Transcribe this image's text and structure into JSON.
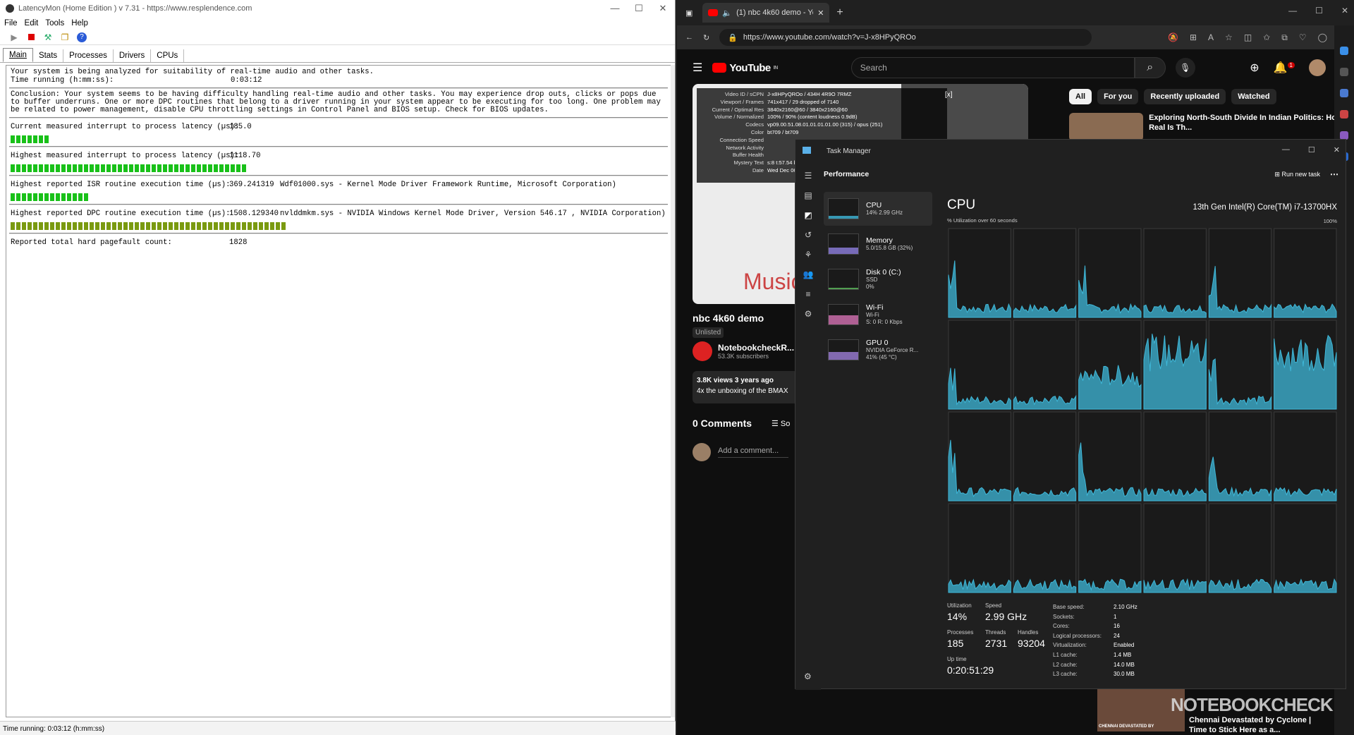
{
  "latencymon": {
    "title": "LatencyMon (Home Edition ) v 7.31 - https://www.resplendence.com",
    "menu": [
      "File",
      "Edit",
      "Tools",
      "Help"
    ],
    "tabs": [
      "Main",
      "Stats",
      "Processes",
      "Drivers",
      "CPUs"
    ],
    "line1": "Your system is being analyzed for suitability of real-time audio and other tasks.",
    "time_label": "Time running (h:mm:ss):",
    "time_value": "0:03:12",
    "conclusion": "Conclusion: Your system seems to be having difficulty handling real-time audio and other tasks. You may experience drop outs, clicks or pops due to buffer underruns. One or more DPC routines that belong to a driver running in your system appear to be executing for too long. One problem may be related to power management, disable CPU throttling settings in Control Panel and BIOS setup. Check for BIOS updates.",
    "metrics": [
      {
        "label": "Current measured interrupt to process latency (µs):",
        "value": "185.0",
        "detail": "",
        "bar_fraction": 0.14,
        "color": "#19c119"
      },
      {
        "label": "Highest measured interrupt to process latency (µs):",
        "value": "1118.70",
        "detail": "",
        "bar_fraction": 0.83,
        "color": "#19c119"
      },
      {
        "label": "Highest reported ISR routine execution time (µs):",
        "value": "369.241319",
        "detail": "Wdf01000.sys - Kernel Mode Driver Framework Runtime, Microsoft Corporation)",
        "bar_fraction": 0.28,
        "color": "#19c119"
      },
      {
        "label": "Highest reported DPC routine execution time (µs):",
        "value": "1508.129340",
        "detail": "nvlddmkm.sys - NVIDIA Windows Kernel Mode Driver, Version 546.17 , NVIDIA Corporation)",
        "bar_fraction": 0.98,
        "color": "#7a9a10"
      },
      {
        "label": "Reported total hard pagefault count:",
        "value": "1828",
        "detail": "",
        "bar_fraction": 0,
        "color": "#19c119"
      }
    ],
    "status": "Time running: 0:03:12  (h:mm:ss)"
  },
  "browser": {
    "tab_title": "(1) nbc 4k60 demo - YouTu",
    "url": "https://www.youtube.com/watch?v=J-x8HPyQROo",
    "yt_logo": "YouTube",
    "yt_country": "IN",
    "search_placeholder": "Search",
    "notif_count": "1",
    "chips": [
      "All",
      "For you",
      "Recently uploaded",
      "Watched"
    ],
    "reco_title": "Exploring North-South Divide In Indian Politics: How Real Is Th...",
    "video_title": "nbc 4k60 demo",
    "unlisted": "Unlisted",
    "channel": "NotebookcheckR...",
    "subscribers": "53.3K subscribers",
    "views": "3.8K views  3 years ago",
    "desc": "4x the unboxing of the BMAX",
    "comments": "0 Comments",
    "sort": "So",
    "add_comment": "Add a comment...",
    "bottom_title": "Chennai Devastated by Cyclone | Time to Stick Here as a...",
    "bottom_thumb_text": "CHENNAI DEVASTATED BY",
    "watermark": "NOTEBOOKCHECK",
    "music_text": "Music",
    "stats": [
      {
        "k": "Video ID / sCPN",
        "v": "J-x8HPyQROo / 434H 4R9O 7RMZ"
      },
      {
        "k": "Viewport / Frames",
        "v": "741x417 / 29 dropped of 7140"
      },
      {
        "k": "Current / Optimal Res",
        "v": "3840x2160@60 / 3840x2160@60"
      },
      {
        "k": "Volume / Normalized",
        "v": "100% / 90% (content loudness 0.9dB)"
      },
      {
        "k": "Codecs",
        "v": "vp09.00.51.08.01.01.01.01.00 (315) / opus (251)"
      },
      {
        "k": "Color",
        "v": "bt709 / bt709"
      },
      {
        "k": "Connection Speed",
        "v": ""
      },
      {
        "k": "Network Activity",
        "v": ""
      },
      {
        "k": "Buffer Health",
        "v": ""
      },
      {
        "k": "Mystery Text",
        "v": "s:8 t:57.54 b"
      },
      {
        "k": "Date",
        "v": "Wed Dec 06"
      }
    ]
  },
  "taskmanager": {
    "title": "Task Manager",
    "section": "Performance",
    "run_task": "Run new task",
    "devices": [
      {
        "name": "CPU",
        "sub1": "14% 2.99 GHz",
        "sub2": "",
        "color": "#3fb8d9",
        "fill": 0.14
      },
      {
        "name": "Memory",
        "sub1": "5.0/15.8 GB (32%)",
        "sub2": "",
        "color": "#8f7fe0",
        "fill": 0.32
      },
      {
        "name": "Disk 0 (C:)",
        "sub1": "SSD",
        "sub2": "0%",
        "color": "#5fbf5f",
        "fill": 0
      },
      {
        "name": "Wi-Fi",
        "sub1": "Wi-Fi",
        "sub2": "S: 0 R: 0 Kbps",
        "color": "#d472b3",
        "fill": 0.45
      },
      {
        "name": "GPU 0",
        "sub1": "NVIDIA GeForce R...",
        "sub2": "41% (45 °C)",
        "color": "#9c7dd6",
        "fill": 0.41
      }
    ],
    "cpu_title": "CPU",
    "cpu_name": "13th Gen Intel(R) Core(TM) i7-13700HX",
    "util_label": "% Utilization over 60 seconds",
    "max_label": "100%",
    "stats": {
      "utilization_label": "Utilization",
      "utilization": "14%",
      "speed_label": "Speed",
      "speed": "2.99 GHz",
      "processes_label": "Processes",
      "processes": "185",
      "threads_label": "Threads",
      "threads": "2731",
      "handles_label": "Handles",
      "handles": "93204",
      "uptime_label": "Up time",
      "uptime": "0:20:51:29"
    },
    "specs": [
      {
        "k": "Base speed:",
        "v": "2.10 GHz"
      },
      {
        "k": "Sockets:",
        "v": "1"
      },
      {
        "k": "Cores:",
        "v": "16"
      },
      {
        "k": "Logical processors:",
        "v": "24"
      },
      {
        "k": "Virtualization:",
        "v": "Enabled"
      },
      {
        "k": "L1 cache:",
        "v": "1.4 MB"
      },
      {
        "k": "L2 cache:",
        "v": "14.0 MB"
      },
      {
        "k": "L3 cache:",
        "v": "30.0 MB"
      }
    ],
    "accent": "#3fb8d9"
  }
}
